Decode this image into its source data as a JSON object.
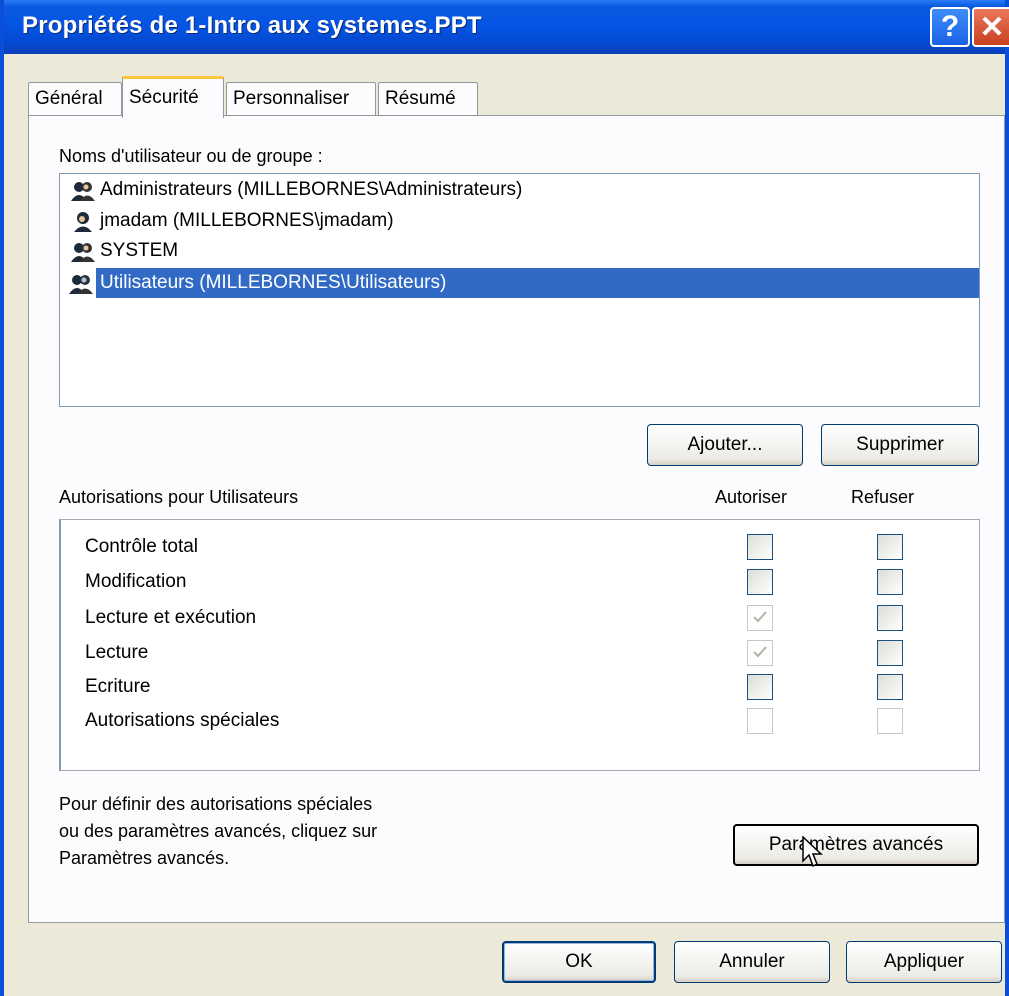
{
  "window": {
    "title": "Propriétés de 1-Intro aux systemes.PPT",
    "help_symbol": "?",
    "close_symbol": "✕"
  },
  "tabs": [
    {
      "label": "Général",
      "active": false
    },
    {
      "label": "Sécurité",
      "active": true
    },
    {
      "label": "Personnaliser",
      "active": false
    },
    {
      "label": "Résumé",
      "active": false
    }
  ],
  "users": {
    "label": "Noms d'utilisateur ou de groupe :",
    "items": [
      {
        "name": "Administrateurs (MILLEBORNES\\Administrateurs)",
        "icon": "group-icon",
        "selected": false
      },
      {
        "name": "jmadam (MILLEBORNES\\jmadam)",
        "icon": "user-icon",
        "selected": false
      },
      {
        "name": "SYSTEM",
        "icon": "group-icon",
        "selected": false
      },
      {
        "name": "Utilisateurs (MILLEBORNES\\Utilisateurs)",
        "icon": "group-icon",
        "selected": true
      }
    ],
    "add_button": "Ajouter...",
    "remove_button": "Supprimer"
  },
  "permissions": {
    "label": "Autorisations pour Utilisateurs",
    "allow_header": "Autoriser",
    "deny_header": "Refuser",
    "rows": [
      {
        "name": "Contrôle total",
        "allow": false,
        "deny": false,
        "enabled": true
      },
      {
        "name": "Modification",
        "allow": false,
        "deny": false,
        "enabled": true
      },
      {
        "name": "Lecture et exécution",
        "allow": true,
        "deny": false,
        "allow_inherited": true,
        "enabled": true
      },
      {
        "name": "Lecture",
        "allow": true,
        "deny": false,
        "allow_inherited": true,
        "enabled": true
      },
      {
        "name": "Ecriture",
        "allow": false,
        "deny": false,
        "enabled": true
      },
      {
        "name": "Autorisations spéciales",
        "allow": false,
        "deny": false,
        "enabled": false
      }
    ]
  },
  "advanced": {
    "line1": "Pour définir des autorisations spéciales",
    "line2": "ou des paramètres avancés, cliquez sur",
    "line3": "Paramètres avancés.",
    "button": "Paramètres avancés"
  },
  "footer": {
    "ok": "OK",
    "cancel": "Annuler",
    "apply": "Appliquer"
  },
  "colors": {
    "selection": "#316ac5",
    "titlebar": "#0555e5",
    "dialog_bg": "#ece9d8"
  }
}
